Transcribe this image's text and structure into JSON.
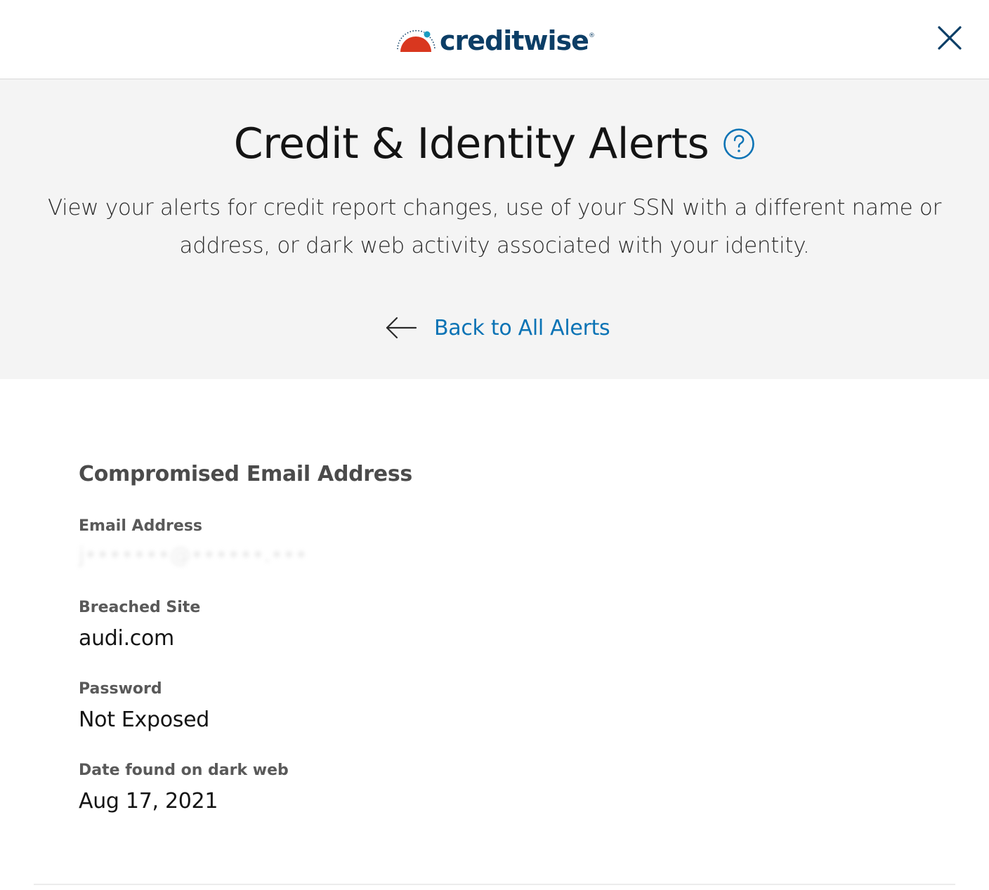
{
  "header": {
    "logo_text": "creditwise",
    "logo_reg": "®",
    "brand_colors": {
      "navy": "#0c3e66",
      "red": "#d9371f",
      "teal": "#1a9cc1"
    }
  },
  "hero": {
    "title": "Credit & Identity Alerts",
    "description": "View your alerts for credit report changes, use of your SSN with a different name or address, or dark web activity associated with your identity.",
    "back_link_label": "Back to All Alerts"
  },
  "alert": {
    "heading": "Compromised Email Address",
    "fields": [
      {
        "label": "Email Address",
        "value": "j•••••••@••••••.•••"
      },
      {
        "label": "Breached Site",
        "value": "audi.com"
      },
      {
        "label": "Password",
        "value": "Not Exposed"
      },
      {
        "label": "Date found on dark web",
        "value": "Aug 17, 2021"
      }
    ]
  },
  "icons": {
    "close": "close-icon",
    "help": "question-circle-icon",
    "back": "arrow-left-icon"
  },
  "colors": {
    "link": "#0b73b5",
    "hero_bg": "#f4f4f4"
  }
}
